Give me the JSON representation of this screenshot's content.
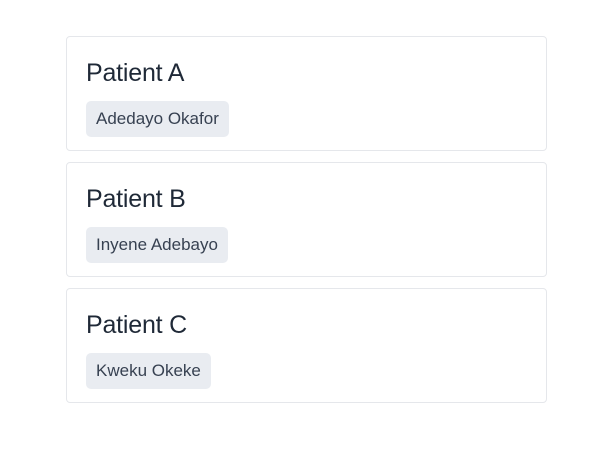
{
  "patients": [
    {
      "title": "Patient A",
      "name": "Adedayo Okafor"
    },
    {
      "title": "Patient B",
      "name": "Inyene Adebayo"
    },
    {
      "title": "Patient C",
      "name": "Kweku Okeke"
    }
  ],
  "colors": {
    "card_border": "#e5e7eb",
    "tag_background": "#e9ecf1",
    "title_text": "#1f2937",
    "tag_text": "#374151"
  }
}
